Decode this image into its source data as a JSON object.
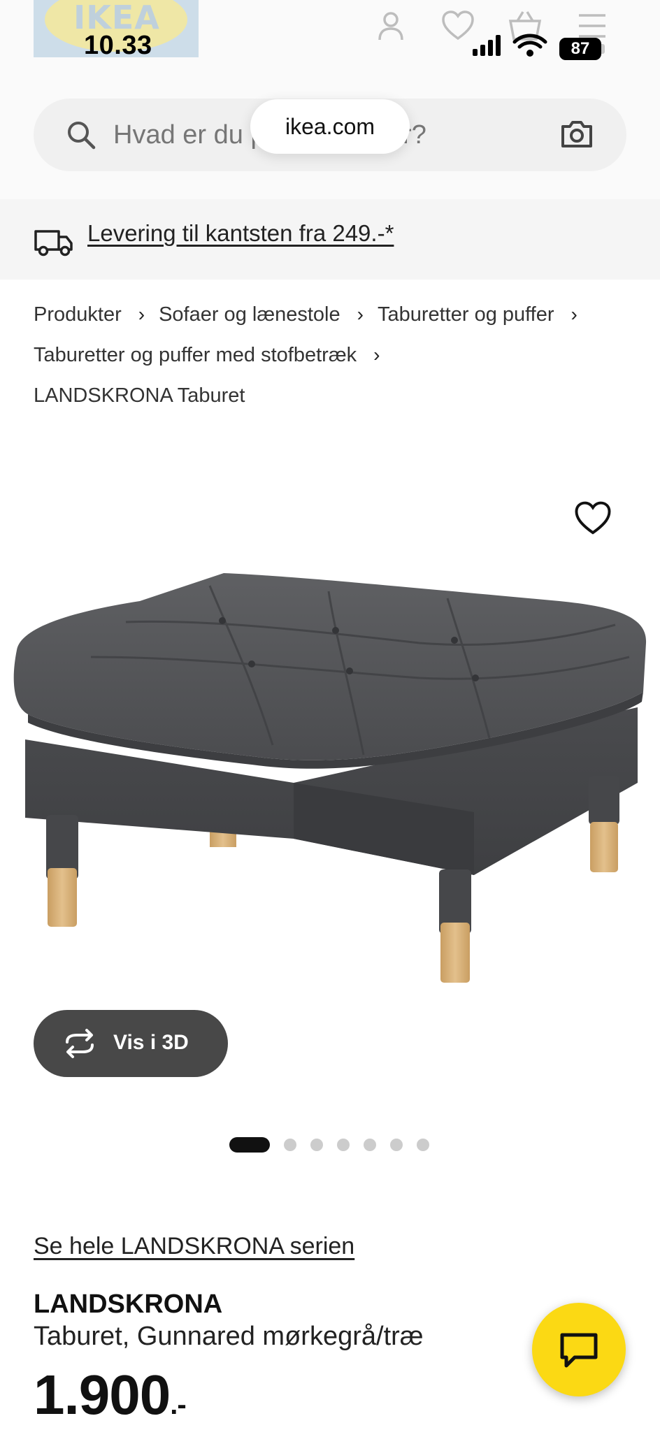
{
  "status_bar": {
    "time": "10.33",
    "battery": "87"
  },
  "logo": {
    "text": "IKEA"
  },
  "header": {
    "icons": [
      "user-icon",
      "heart-icon",
      "basket-icon",
      "menu-icon"
    ]
  },
  "search": {
    "placeholder": "Hvad er du på udkig efter?",
    "url": "ikea.com"
  },
  "delivery": {
    "text": "Levering til kantsten fra 249.-*"
  },
  "breadcrumb": {
    "items": [
      "Produkter",
      "Sofaer og lænestole",
      "Taburetter og puffer",
      "Taburetter og puffer med stofbetræk",
      "LANDSKRONA Taburet"
    ]
  },
  "gallery": {
    "view_3d_label": "Vis i 3D",
    "image_count": 7,
    "active_index": 0
  },
  "product": {
    "series_link": "Se hele LANDSKRONA serien",
    "name": "LANDSKRONA",
    "description": "Taburet, Gunnared mørkegrå/træ",
    "price": "1.900",
    "price_suffix": ".-"
  },
  "colors": {
    "brand_yellow": "#fbd914",
    "button_dark": "#484848",
    "fabric": "#58595b",
    "wood": "#d9b380"
  }
}
